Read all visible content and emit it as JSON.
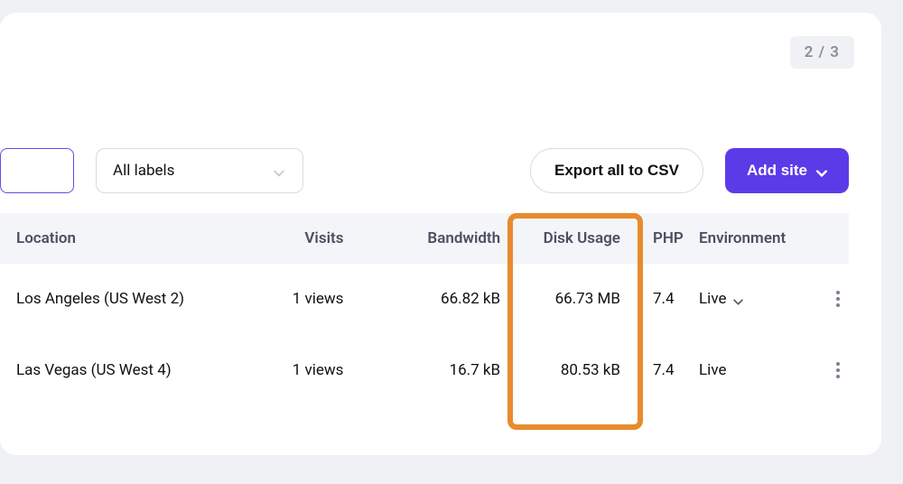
{
  "pagination": {
    "text": "2 / 3"
  },
  "toolbar": {
    "labels_select": "All labels",
    "export_label": "Export all to CSV",
    "add_site_label": "Add site"
  },
  "table": {
    "headers": {
      "location": "Location",
      "visits": "Visits",
      "bandwidth": "Bandwidth",
      "disk": "Disk Usage",
      "php": "PHP",
      "env": "Environment"
    },
    "rows": [
      {
        "location": "Los Angeles (US West 2)",
        "visits": "1 views",
        "bandwidth": "66.82 kB",
        "disk": "66.73 MB",
        "php": "7.4",
        "env": "Live",
        "env_dropdown": true
      },
      {
        "location": "Las Vegas (US West 4)",
        "visits": "1 views",
        "bandwidth": "16.7 kB",
        "disk": "80.53 kB",
        "php": "7.4",
        "env": "Live",
        "env_dropdown": false
      }
    ]
  },
  "highlight": {
    "column": "disk"
  }
}
